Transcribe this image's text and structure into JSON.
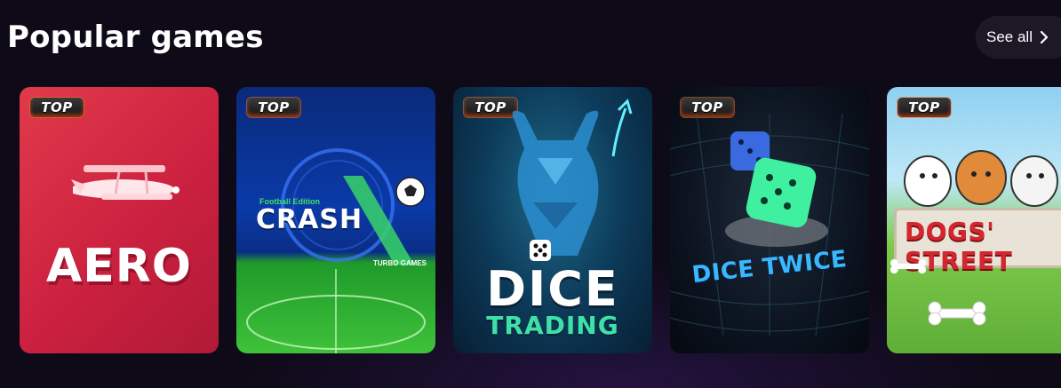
{
  "section": {
    "title": "Popular games",
    "see_all_label": "See all"
  },
  "games": [
    {
      "name": "Aero",
      "badge": "TOP",
      "title_text": "AERO"
    },
    {
      "name": "Crash",
      "badge": "TOP",
      "subtitle": "Football Edition",
      "title_text": "CRASH",
      "brand": "TURBO GAMES"
    },
    {
      "name": "Dice Trading",
      "badge": "TOP",
      "title_line1": "DICE",
      "title_line2": "TRADING"
    },
    {
      "name": "Dice Twice",
      "badge": "TOP",
      "title_text": "DICE TWICE"
    },
    {
      "name": "Dogs' Street",
      "badge": "TOP",
      "title_text": "DOGS' STREET"
    }
  ],
  "colors": {
    "background": "#0f0a18",
    "aero_bg": "#cc2140",
    "crash_bg": "#0a3aa8",
    "dice_trading_accent": "#3fe0a8",
    "dice_twice_accent": "#3ab8ff",
    "dogs_title": "#d3262e"
  },
  "icons": {
    "see_all_arrow": "chevron-right-icon"
  }
}
